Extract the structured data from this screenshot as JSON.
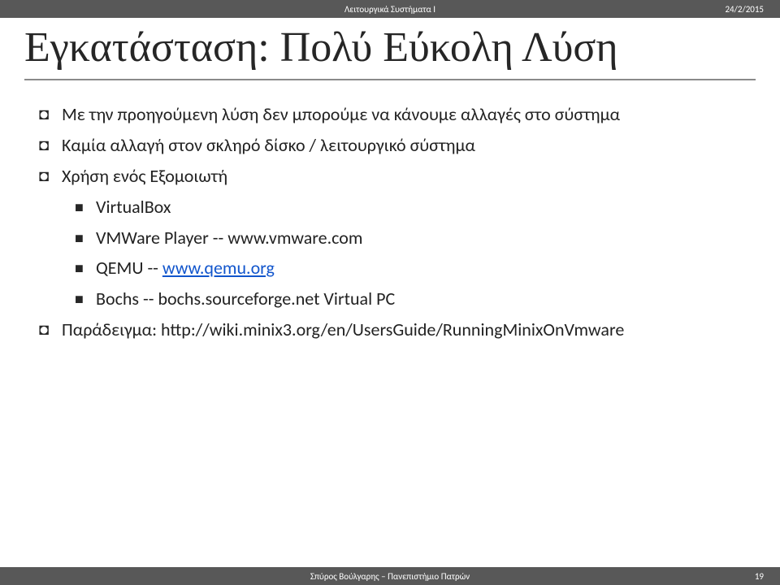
{
  "header": {
    "course": "Λειτουργικά Συστήματα Ι",
    "date": "24/2/2015"
  },
  "title": "Εγκατάσταση: Πολύ Εύκολη Λύση",
  "bullets": [
    {
      "level": 1,
      "text": "Με την προηγούμενη λύση δεν μπορούμε να κάνουμε αλλαγές στο σύστημα"
    },
    {
      "level": 1,
      "text": "Καμία αλλαγή στον σκληρό δίσκο / λειτουργικό σύστημα"
    },
    {
      "level": 1,
      "text": "Χρήση ενός Εξομοιωτή"
    },
    {
      "level": 2,
      "text": "VirtualBox"
    },
    {
      "level": 2,
      "text": "VMWare Player -- www.vmware.com"
    },
    {
      "level": 2,
      "pre": "QEMU -- ",
      "link": "www.qemu.org"
    },
    {
      "level": 2,
      "text": "Bochs -- bochs.sourceforge.net Virtual PC"
    },
    {
      "level": 1,
      "text": "Παράδειγμα: http://wiki.minix3.org/en/UsersGuide/RunningMinixOnVmware"
    }
  ],
  "footer": {
    "author": "Σπύρος Βούλγαρης – Πανεπιστήμιο Πατρών",
    "page": "19"
  }
}
